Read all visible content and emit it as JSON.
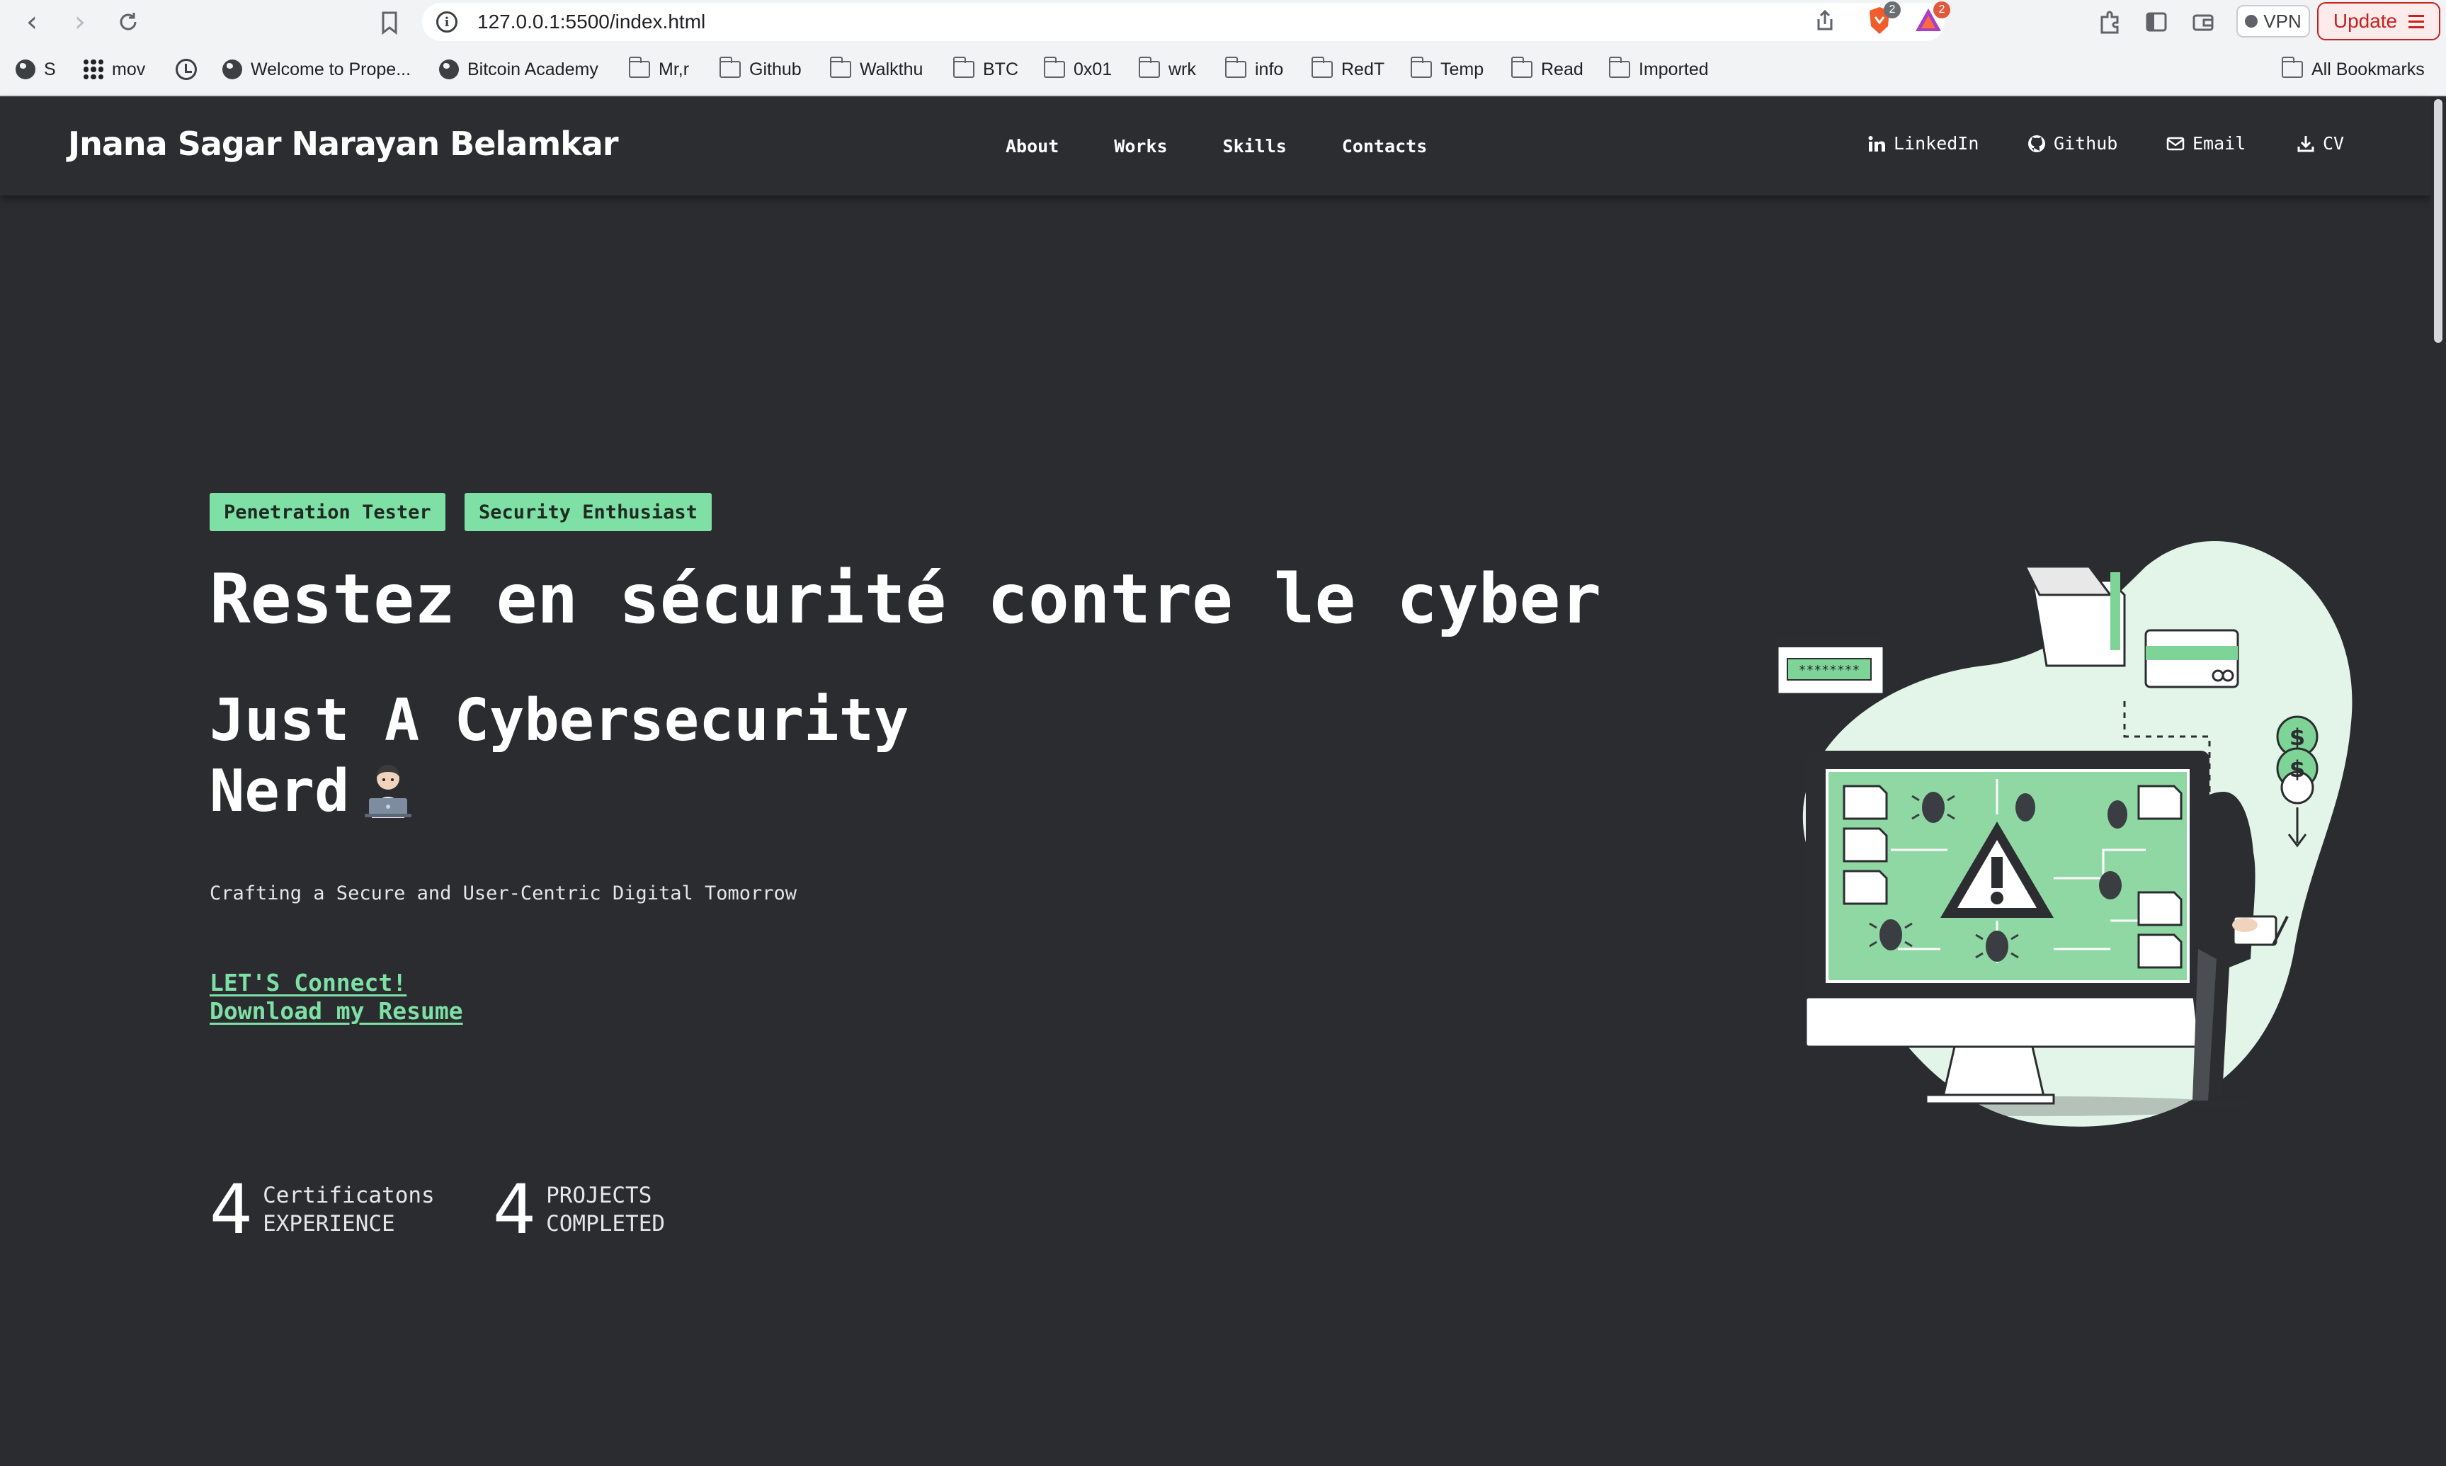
{
  "browser": {
    "url": "127.0.0.1:5500/index.html",
    "brave_badge": "2",
    "rewards_badge": "2",
    "vpn_label": "VPN",
    "update_label": "Update",
    "bookmarks": [
      {
        "label": "S",
        "icon": "globe-icon"
      },
      {
        "label": "mov",
        "icon": "grid-icon"
      },
      {
        "label": "",
        "icon": "history-icon"
      },
      {
        "label": "Welcome to Prope...",
        "icon": "globe-icon"
      },
      {
        "label": "Bitcoin Academy",
        "icon": "globe-icon"
      },
      {
        "label": "Mr,r",
        "icon": "folder-icon"
      },
      {
        "label": "Github",
        "icon": "folder-icon"
      },
      {
        "label": "Walkthu",
        "icon": "folder-icon"
      },
      {
        "label": "BTC",
        "icon": "folder-icon"
      },
      {
        "label": "0x01",
        "icon": "folder-icon"
      },
      {
        "label": "wrk",
        "icon": "folder-icon"
      },
      {
        "label": "info",
        "icon": "folder-icon"
      },
      {
        "label": "RedT",
        "icon": "folder-icon"
      },
      {
        "label": "Temp",
        "icon": "folder-icon"
      },
      {
        "label": "Read",
        "icon": "folder-icon"
      },
      {
        "label": "Imported",
        "icon": "folder-icon"
      }
    ],
    "all_bookmarks": "All Bookmarks"
  },
  "site": {
    "logo": "Jnana Sagar Narayan Belamkar",
    "nav": [
      "About",
      "Works",
      "Skills",
      "Contacts"
    ],
    "social": {
      "linkedin": "LinkedIn",
      "github": "Github",
      "email": "Email",
      "cv": "CV"
    }
  },
  "hero": {
    "tags": [
      "Penetration Tester",
      "Security Enthusiast"
    ],
    "title": "Restez en sécurité contre le cyber",
    "subtitle_line1": "Just A Cybersecurity",
    "subtitle_line2": "Nerd",
    "description": "Crafting a Secure and User-Centric Digital Tomorrow",
    "link_connect": "LET'S Connect!",
    "link_resume": "Download my Resume"
  },
  "stats": [
    {
      "number": "4",
      "line1": "Certificatons",
      "line2": "EXPERIENCE"
    },
    {
      "number": "4",
      "line1": "PROJECTS",
      "line2": "COMPLETED"
    }
  ],
  "colors": {
    "accent": "#7ee0a4",
    "background": "#2a2c30",
    "header": "#2b2d31"
  }
}
